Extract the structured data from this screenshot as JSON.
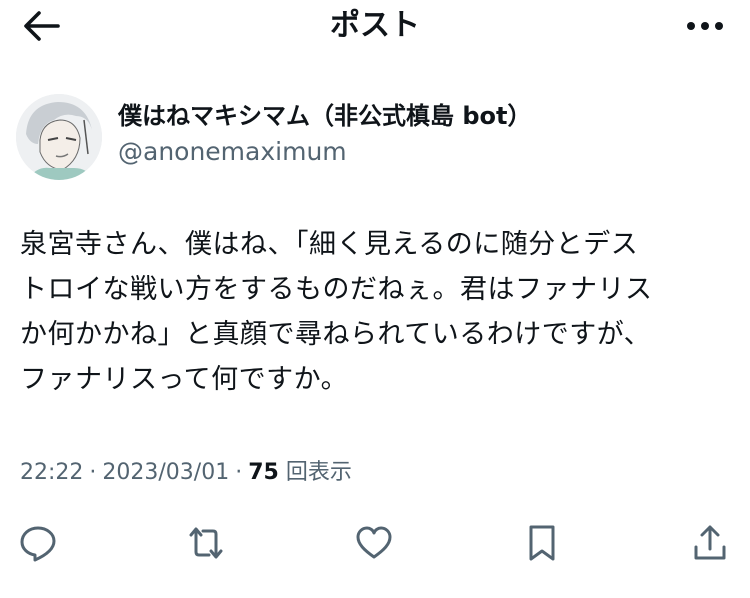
{
  "header": {
    "title": "ポスト",
    "back_icon": "arrow-left-icon",
    "more_icon": "more-dots-icon"
  },
  "author": {
    "name": "僕はねマキシマム（非公式槙島 bot）",
    "handle": "@anonemaximum",
    "avatar_icon": "avatar-anime-portrait"
  },
  "post": {
    "lines": [
      "泉宮寺さん、僕はね、「細く見えるのに随分とデス",
      "トロイな戦い方をするものだねぇ。君はファナリス",
      "か何かかね」と真顔で尋ねられているわけですが、",
      "ファナリスって何ですか。"
    ]
  },
  "meta": {
    "time": "22:22",
    "separator": "·",
    "date": "2023/03/01",
    "views_count": "75",
    "views_label": "回表示"
  },
  "actions": {
    "icons": [
      "reply-icon",
      "repost-icon",
      "like-icon",
      "bookmark-icon",
      "share-icon"
    ]
  },
  "colors": {
    "text": "#0f1419",
    "secondary": "#536471",
    "background": "#ffffff"
  }
}
